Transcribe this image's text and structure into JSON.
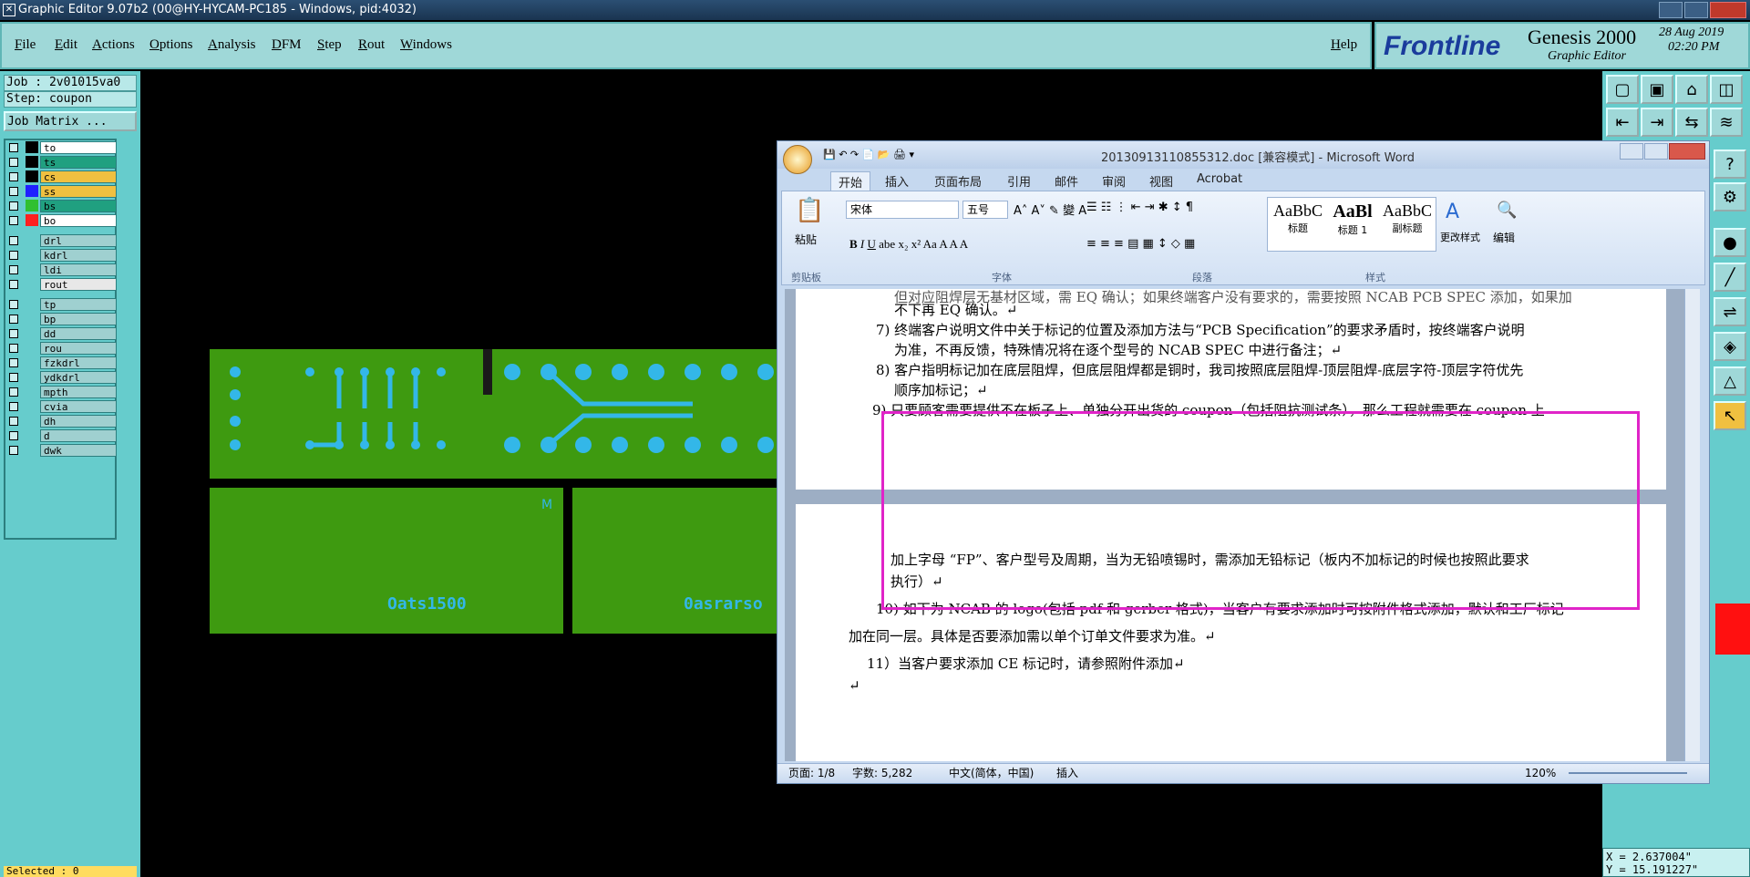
{
  "titlebar": {
    "title": "Graphic Editor 9.07b2 (00@HY-HYCAM-PC185 - Windows, pid:4032)"
  },
  "menu": {
    "items": [
      "File",
      "Edit",
      "Actions",
      "Options",
      "Analysis",
      "DFM",
      "Step",
      "Rout",
      "Windows"
    ],
    "help": "Help"
  },
  "brand": {
    "logo": "Frontline",
    "product": "Genesis 2000",
    "subtitle": "Graphic Editor",
    "date": "28 Aug 2019",
    "time": "02:20 PM"
  },
  "job": {
    "job": "Job : 2v01015va0",
    "step": "Step: coupon",
    "matrix": "Job Matrix ..."
  },
  "layers": {
    "group1": [
      {
        "name": "to",
        "color": "#ffffff",
        "sw": "#000000"
      },
      {
        "name": "ts",
        "color": "#20a080",
        "sw": "#000000"
      },
      {
        "name": "cs",
        "color": "#f0c040",
        "sw": "#000000"
      },
      {
        "name": "ss",
        "color": "#f0c040",
        "sw": "#2020ff"
      },
      {
        "name": "bs",
        "color": "#20a080",
        "sw": "#30c030"
      },
      {
        "name": "bo",
        "color": "#ffffff",
        "sw": "#ff2020"
      }
    ],
    "group2": [
      {
        "name": "drl",
        "color": "#9fd0d0"
      },
      {
        "name": "kdrl",
        "color": "#9fd0d0"
      },
      {
        "name": "ldi",
        "color": "#9fd0d0"
      },
      {
        "name": "rout",
        "color": "#e8e8e8"
      }
    ],
    "group3": [
      {
        "name": "tp"
      },
      {
        "name": "bp"
      },
      {
        "name": "dd"
      },
      {
        "name": "rou"
      },
      {
        "name": "fzkdrl"
      },
      {
        "name": "ydkdrl"
      },
      {
        "name": "mpth"
      },
      {
        "name": "cvia"
      },
      {
        "name": "dh"
      },
      {
        "name": "d"
      },
      {
        "name": "dwk"
      }
    ]
  },
  "status": {
    "selected": "Selected : 0",
    "x": "X = 2.637004\"",
    "y": "Y = 15.191227\""
  },
  "pcb": {
    "label1": "Oats1500",
    "label1b": "0asrarso",
    "label2": "Oats1500",
    "m": "M"
  },
  "word": {
    "title": "20130913110855312.doc [兼容模式] - Microsoft Word",
    "tabs": [
      "开始",
      "插入",
      "页面布局",
      "引用",
      "邮件",
      "审阅",
      "视图",
      "Acrobat"
    ],
    "groups": [
      "剪贴板",
      "字体",
      "段落",
      "样式",
      "编辑"
    ],
    "paste": "粘贴",
    "font": "宋体",
    "size": "五号",
    "styles": [
      {
        "sample": "AaBbC",
        "name": "标题"
      },
      {
        "sample": "AaBl",
        "name": "标题 1"
      },
      {
        "sample": "AaBbC",
        "name": "副标题"
      }
    ],
    "change_styles": "更改样式",
    "lines": [
      "但对应阻焊层无基材区域，需 EQ 确认；如果终端客户没有要求的，需要按照 NCAB PCB SPEC 添加，如果加",
      "不下再 EQ 确认。↵",
      "7)   终端客户说明文件中关于标记的位置及添加方法与“PCB Specification”的要求矛盾时，按终端客户说明",
      "为准，不再反馈，特殊情况将在逐个型号的 NCAB SPEC 中进行备注；↵",
      "8)   客户指明标记加在底层阻焊，但底层阻焊都是铜时，我司按照底层阻焊-顶层阻焊-底层字符-顶层字符优先",
      "顺序加标记；↵",
      "9)  只要顾客需要提供不在板子上、单独分开出货的 coupon（包括阻抗测试条），那么工程就需要在 coupon 上",
      "加上字母 “FP”、客户型号及周期，当为无铅喷锡时，需添加无铅标记（板内不加标记的时候也按照此要求",
      "执行）↵",
      "10)  如下为 NCAB 的 logo(包括 pdf 和 gerber 格式)，当客户有要求添加时可按附件格式添加，默认和工厂标记",
      "加在同一层。具体是否要添加需以单个订单文件要求为准。↵",
      "11）当客户要求添加 CE 标记时，请参照附件添加↵",
      "↵"
    ],
    "status": {
      "page": "页面: 1/8",
      "words": "字数: 5,282",
      "lang": "中文(简体，中国)",
      "mode": "插入",
      "zoom": "120%"
    }
  }
}
